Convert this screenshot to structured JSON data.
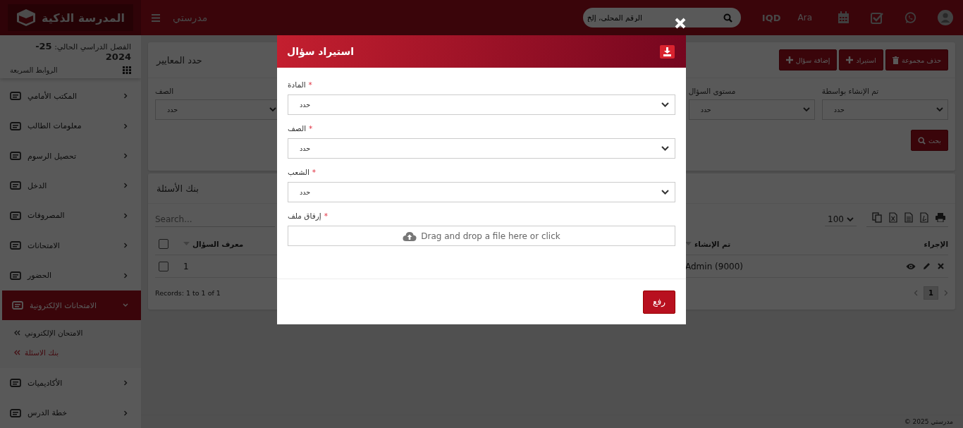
{
  "topbar": {
    "logo_text": "المدرسة الذكية",
    "app_name": "مدرستي",
    "search": {
      "placeholder": "الرقم المحلي، إلخ"
    },
    "currency": "IQD",
    "language": "Ara"
  },
  "sidebar": {
    "semester": "الفصل الدراسي الحالي: **25-2024**",
    "quick_links": "الروابط السريعة",
    "items": [
      {
        "label": "المكتب الأمامي",
        "expanded": false,
        "selected": false
      },
      {
        "label": "معلومات الطالب",
        "expanded": false,
        "selected": false
      },
      {
        "label": "تحصيل الرسوم",
        "expanded": false,
        "selected": false
      },
      {
        "label": "الدخل",
        "expanded": false,
        "selected": false
      },
      {
        "label": "المصروفات",
        "expanded": false,
        "selected": false
      },
      {
        "label": "الامتحانات",
        "expanded": false,
        "selected": false
      },
      {
        "label": "الحضور",
        "expanded": false,
        "selected": false
      },
      {
        "label": "الامتحانات الإلكترونية",
        "expanded": true,
        "selected": true,
        "children": [
          {
            "label": "الامتحان الإلكتروني",
            "selected": false
          },
          {
            "label": "بنك الاسئلة",
            "selected": true
          }
        ]
      },
      {
        "label": "الأكاديميات",
        "expanded": false,
        "selected": false
      },
      {
        "label": "خطة الدرس",
        "expanded": false,
        "selected": false
      }
    ]
  },
  "criteria": {
    "title": "حدد المعايير",
    "actions": [
      {
        "label": "حذف مجموعة",
        "kind": "delete"
      },
      {
        "label": "استيراد",
        "kind": "add"
      },
      {
        "label": "إضافة سؤال",
        "kind": "add"
      }
    ],
    "filters_left": [
      {
        "label": "الصف",
        "value": "حدد"
      }
    ],
    "filters_right": [
      {
        "label": "تم الإنشاء بواسطة",
        "value": "حدد"
      },
      {
        "label": "مستوى السؤال",
        "value": "حدد"
      }
    ],
    "search_button": "بحث"
  },
  "bank": {
    "title": "بنك الأسئلة",
    "search": {
      "placeholder": "Search..."
    },
    "page_size": "100",
    "columns": [
      {
        "label": "الإجراء"
      },
      {
        "label": "تم الإنشاء"
      },
      {
        "label": "معرف السؤال",
        "checked": false
      }
    ],
    "rows": [
      {
        "checked": false,
        "cells": [
          "",
          "Admin (9000)",
          "1"
        ]
      }
    ],
    "records": "Records: 1 to 1 of 1",
    "pages": [
      {
        "label": "1",
        "selected": true
      }
    ]
  },
  "footer": "مدرستي 2025 ©",
  "modal": {
    "title": "استيراد سؤال",
    "required_mark": "*",
    "fields": [
      {
        "label": "المادة",
        "required": true,
        "kind": "select",
        "value": "حدد"
      },
      {
        "label": "الصف",
        "required": true,
        "kind": "select",
        "value": "حدد"
      },
      {
        "label": "الشعب",
        "required": true,
        "kind": "select",
        "value": "حدد"
      },
      {
        "label": "إرفاق ملف",
        "required": true,
        "kind": "file",
        "value": "Drag and drop a file here or click"
      }
    ],
    "submit": "رفع"
  }
}
